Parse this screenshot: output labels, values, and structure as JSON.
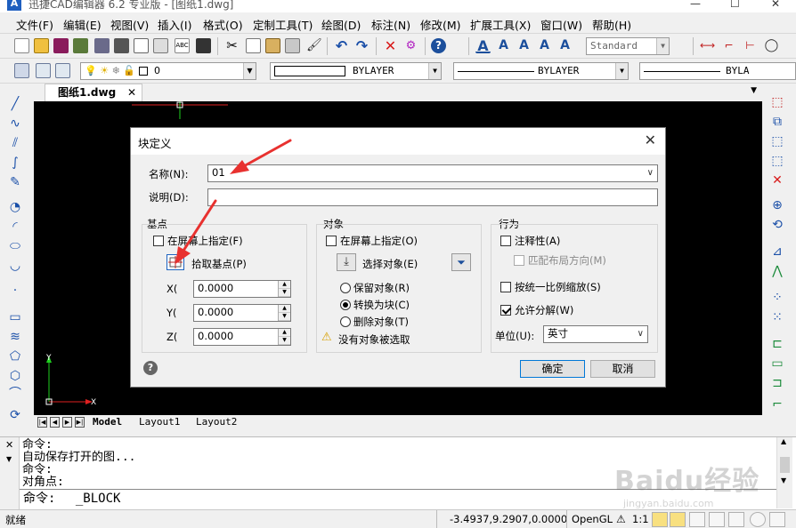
{
  "app": {
    "icon_text": "A",
    "title": "迅捷CAD编辑器 6.2 专业版 - [图纸1.dwg]"
  },
  "menu": [
    "文件(F)",
    "编辑(E)",
    "视图(V)",
    "插入(I)",
    "格式(O)",
    "定制工具(T)",
    "绘图(D)",
    "标注(N)",
    "修改(M)",
    "扩展工具(X)",
    "窗口(W)",
    "帮助(H)"
  ],
  "toolbar": {
    "text_style": "Standard",
    "layer": "0",
    "color": "BYLAYER",
    "linetype": "BYLAYER",
    "lineweight": "BYLA"
  },
  "document_tab": {
    "name": "图纸1.dwg",
    "close": "✕"
  },
  "layout_tabs": [
    "Model",
    "Layout1",
    "Layout2"
  ],
  "dialog": {
    "title": "块定义",
    "close": "✕",
    "name_label": "名称(N):",
    "name_value": "01",
    "desc_label": "说明(D):",
    "desc_value": "",
    "basepoint": {
      "title": "基点",
      "specify_on_screen": "在屏幕上指定(F)",
      "specify_checked": false,
      "pick_point": "拾取基点(P)",
      "x_label": "X(",
      "x_value": "0.0000",
      "y_label": "Y(",
      "y_value": "0.0000",
      "z_label": "Z(",
      "z_value": "0.0000"
    },
    "objects": {
      "title": "对象",
      "specify_on_screen": "在屏幕上指定(O)",
      "specify_checked": false,
      "select_objects": "选择对象(E)",
      "retain": "保留对象(R)",
      "convert": "转换为块(C)",
      "delete": "删除对象(T)",
      "selected_option": "convert",
      "warning": "没有对象被选取"
    },
    "behavior": {
      "title": "行为",
      "annotative": "注释性(A)",
      "annotative_checked": false,
      "match_layout": "匹配布局方向(M)",
      "scale_uniform": "按统一比例缩放(S)",
      "scale_uniform_checked": false,
      "allow_explode": "允许分解(W)",
      "allow_explode_checked": true,
      "units_label": "单位(U):",
      "units_value": "英寸"
    },
    "help_icon": "?",
    "ok": "确定",
    "cancel": "取消"
  },
  "command": {
    "history": [
      "命令:",
      "自动保存打开的图...",
      "命令:",
      "对角点:"
    ],
    "prompt": "命令:",
    "input": "_BLOCK",
    "close_icon": "✕"
  },
  "status": {
    "ready": "就绪",
    "coords": "-3.4937,9.2907,0.0000",
    "renderer": "OpenGL",
    "scale": "1:1"
  },
  "watermark": {
    "brand": "Baidu经验",
    "url": "jingyan.baidu.com"
  },
  "colors": {
    "canvas": "#000000",
    "arrow": "#e8312f",
    "accent": "#0078d7"
  }
}
